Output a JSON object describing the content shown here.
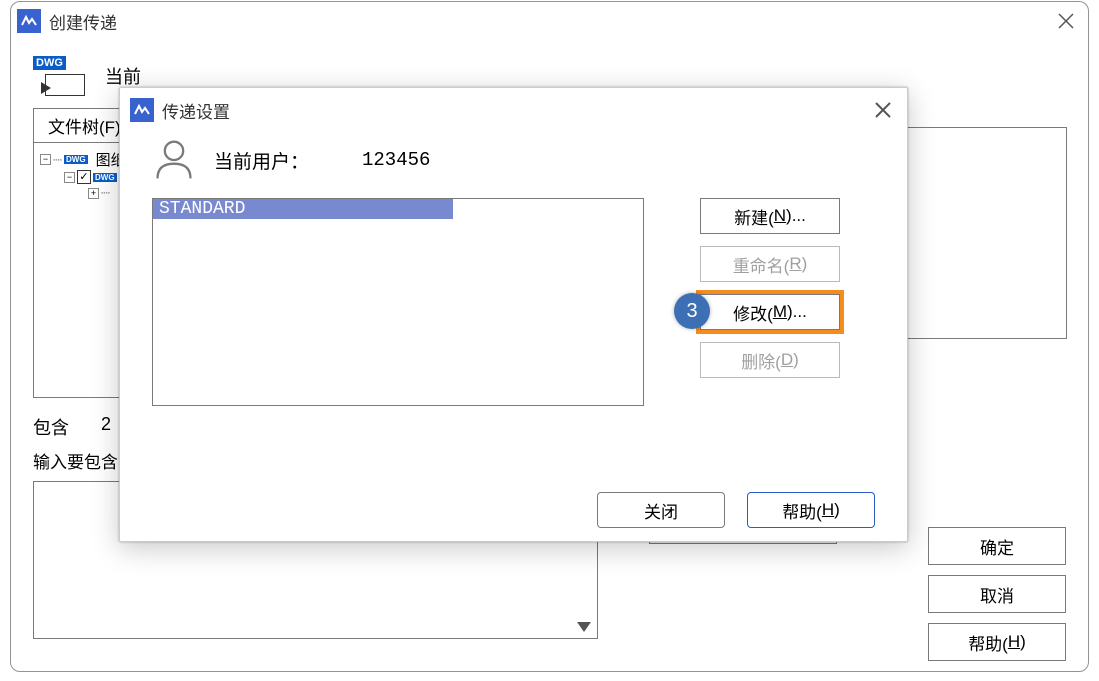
{
  "mainWindow": {
    "title": "创建传递",
    "currentPrefix": "当前",
    "tabs": {
      "fileTree": "文件树(F)"
    },
    "tree": {
      "root": "图纸"
    },
    "include": {
      "label": "包含",
      "extra": "2",
      "desc": "输入要包含"
    },
    "buttons": {
      "ok": "确定",
      "cancel": "取消",
      "helpPre": "帮助(",
      "helpKey": "H",
      "helpPost": ")"
    }
  },
  "dialog": {
    "title": "传递设置",
    "currentUserLabel": "当前用户：",
    "currentUserValue": "123456",
    "list": {
      "item": "STANDARD"
    },
    "buttons": {
      "newPre": "新建(",
      "newKey": "N",
      "newPost": ")...",
      "renamePre": "重命名(",
      "renameKey": "R",
      "renamePost": ")",
      "modifyPre": "修改(",
      "modifyKey": "M",
      "modifyPost": ")...",
      "deletePre": "删除(",
      "deleteKey": "D",
      "deletePost": ")"
    },
    "step": "3",
    "footer": {
      "close": "关闭",
      "helpPre": "帮助(",
      "helpKey": "H",
      "helpPost": ")"
    }
  }
}
